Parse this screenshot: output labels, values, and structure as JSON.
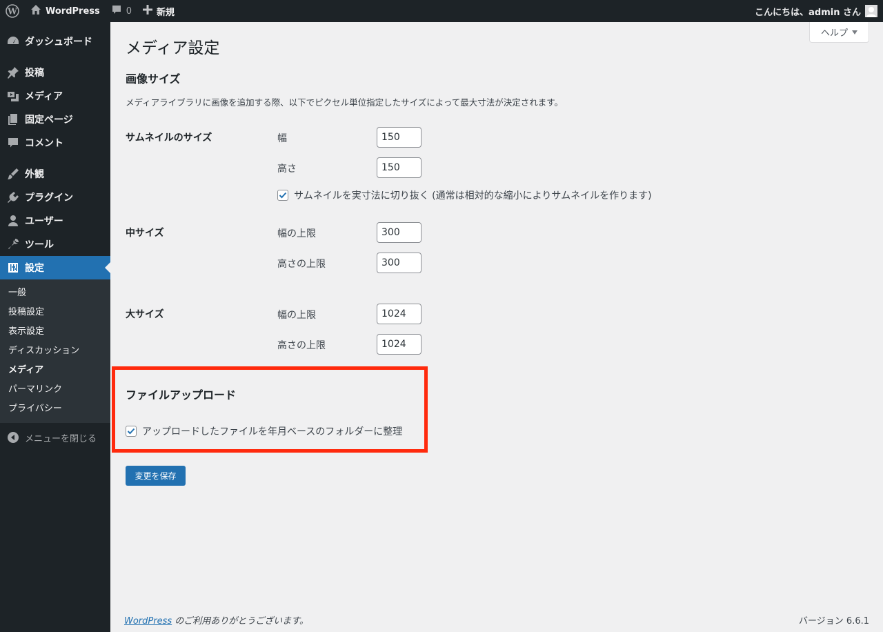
{
  "adminbar": {
    "site_name": "WordPress",
    "comments_count": "0",
    "new_label": "新規",
    "greeting": "こんにちは、admin さん"
  },
  "sidebar": {
    "items": [
      {
        "label": "ダッシュボード",
        "icon": "dashboard-icon"
      },
      {
        "label": "投稿",
        "icon": "pin-icon"
      },
      {
        "label": "メディア",
        "icon": "media-icon"
      },
      {
        "label": "固定ページ",
        "icon": "page-icon"
      },
      {
        "label": "コメント",
        "icon": "comment-icon"
      },
      {
        "label": "外観",
        "icon": "brush-icon"
      },
      {
        "label": "プラグイン",
        "icon": "plugin-icon"
      },
      {
        "label": "ユーザー",
        "icon": "user-icon"
      },
      {
        "label": "ツール",
        "icon": "wrench-icon"
      },
      {
        "label": "設定",
        "icon": "settings-icon"
      }
    ],
    "submenu": [
      "一般",
      "投稿設定",
      "表示設定",
      "ディスカッション",
      "メディア",
      "パーマリンク",
      "プライバシー"
    ],
    "collapse_label": "メニューを閉じる"
  },
  "help_label": "ヘルプ",
  "page": {
    "title": "メディア設定",
    "image_sizes_heading": "画像サイズ",
    "description": "メディアライブラリに画像を追加する際、以下でピクセル単位指定したサイズによって最大寸法が決定されます。",
    "thumbnail": {
      "label": "サムネイルのサイズ",
      "width_label": "幅",
      "width_value": "150",
      "height_label": "高さ",
      "height_value": "150",
      "crop_label": "サムネイルを実寸法に切り抜く (通常は相対的な縮小によりサムネイルを作ります)",
      "crop_checked": true
    },
    "medium": {
      "label": "中サイズ",
      "width_label": "幅の上限",
      "width_value": "300",
      "height_label": "高さの上限",
      "height_value": "300"
    },
    "large": {
      "label": "大サイズ",
      "width_label": "幅の上限",
      "width_value": "1024",
      "height_label": "高さの上限",
      "height_value": "1024"
    },
    "upload": {
      "heading": "ファイルアップロード",
      "organize_label": "アップロードしたファイルを年月ベースのフォルダーに整理",
      "organize_checked": true
    },
    "save_label": "変更を保存"
  },
  "footer": {
    "wp_link": "WordPress",
    "thanks": " のご利用ありがとうございます。",
    "version": "バージョン 6.6.1"
  },
  "colors": {
    "accent": "#2271b1",
    "highlight_border": "#ff2a0d"
  }
}
